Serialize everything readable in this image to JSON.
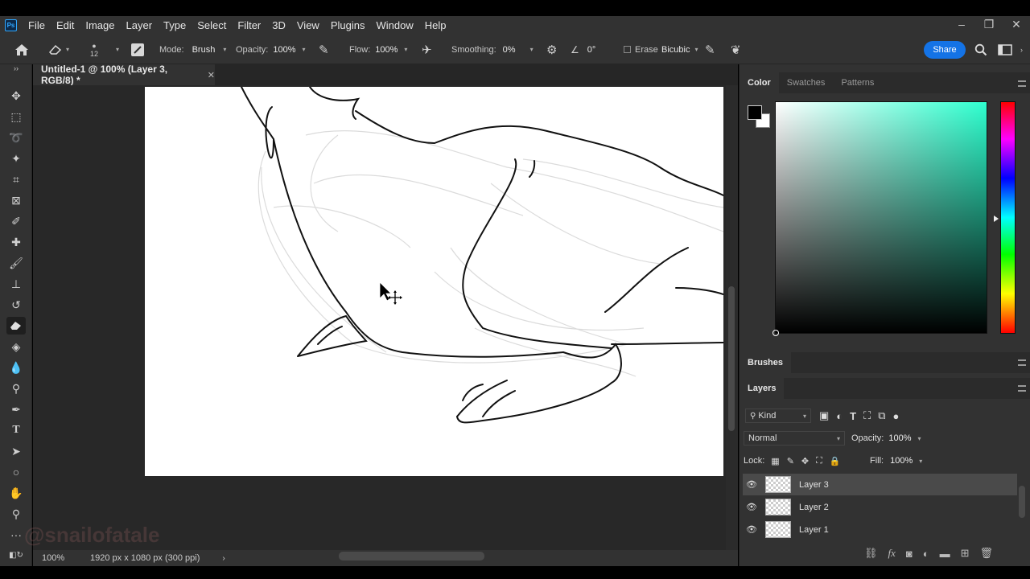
{
  "app": {
    "logo": "Ps"
  },
  "menu": [
    "File",
    "Edit",
    "Image",
    "Layer",
    "Type",
    "Select",
    "Filter",
    "3D",
    "View",
    "Plugins",
    "Window",
    "Help"
  ],
  "options": {
    "brush_size": "12",
    "mode_label": "Mode:",
    "mode_value": "Brush",
    "opacity_label": "Opacity:",
    "opacity_value": "100%",
    "flow_label": "Flow:",
    "flow_value": "100%",
    "smoothing_label": "Smoothing:",
    "smoothing_value": "0%",
    "angle_value": "0°",
    "erase_label": "Erase",
    "resample_value": "Bicubic",
    "share_label": "Share"
  },
  "document": {
    "tab_title": "Untitled-1 @ 100% (Layer 3, RGB/8) *",
    "zoom": "100%",
    "info": "1920 px x 1080 px (300 ppi)"
  },
  "color_panel": {
    "tabs": [
      "Color",
      "Swatches",
      "Patterns"
    ],
    "foreground": "#000000",
    "background": "#ffffff"
  },
  "brushes_panel": {
    "title": "Brushes"
  },
  "layers_panel": {
    "title": "Layers",
    "filter_label": "Kind",
    "blend_mode": "Normal",
    "opacity_label": "Opacity:",
    "opacity_value": "100%",
    "lock_label": "Lock:",
    "fill_label": "Fill:",
    "fill_value": "100%",
    "layers": [
      {
        "name": "Layer 3",
        "selected": true
      },
      {
        "name": "Layer 2",
        "selected": false
      },
      {
        "name": "Layer 1",
        "selected": false
      }
    ]
  },
  "watermark": "@snailofatale"
}
